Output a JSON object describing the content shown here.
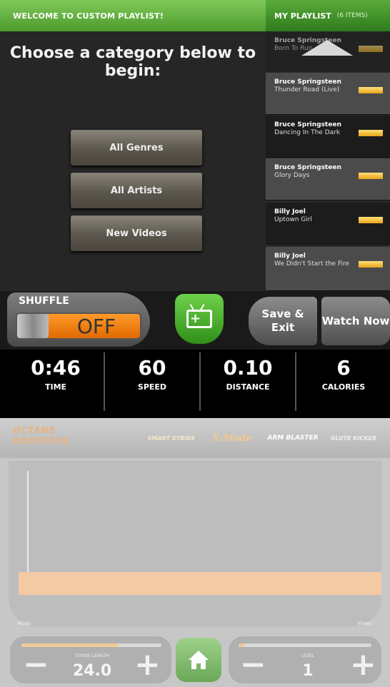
{
  "header": {
    "welcome": "WELCOME TO CUSTOM PLAYLIST!",
    "playlist_title": "MY PLAYLIST",
    "playlist_count": "(6 ITEMS)"
  },
  "prompt": "Choose a category below to begin:",
  "categories": [
    "All Genres",
    "All Artists",
    "New Videos"
  ],
  "playlist": [
    {
      "artist": "Bruce Springsteen",
      "song": "Born To Run"
    },
    {
      "artist": "Bruce Springsteen",
      "song": "Thunder Road (Live)"
    },
    {
      "artist": "Bruce Springsteen",
      "song": "Dancing In The Dark"
    },
    {
      "artist": "Bruce Springsteen",
      "song": "Glory Days"
    },
    {
      "artist": "Billy Joel",
      "song": "Uptown Girl"
    },
    {
      "artist": "Billy Joel",
      "song": "We Didn't Start the Fire"
    }
  ],
  "controls": {
    "shuffle_label": "SHUFFLE",
    "shuffle_state": "OFF",
    "save_exit": "Save & Exit",
    "watch_now": "Watch Now"
  },
  "stats": [
    {
      "value": "0:46",
      "label": "TIME"
    },
    {
      "value": "60",
      "label": "SPEED"
    },
    {
      "value": "0.10",
      "label": "DISTANCE"
    },
    {
      "value": "6",
      "label": "CALORIES"
    }
  ],
  "boosters": {
    "title": "OCTANE BOOSTERS",
    "tabs": [
      "SMART STRIDE",
      "X-Mode",
      "ARM BLASTER",
      "GLUTE KICKER"
    ],
    "left_label": "Mode",
    "right_label": "Views"
  },
  "bottom": {
    "stride_label": "STRIDE LENGTH",
    "stride_value": "24.0",
    "level_label": "LEVEL",
    "level_value": "1"
  },
  "colors": {
    "header_green": "#5aaa3a",
    "accent_orange": "#f28a1a",
    "playlist_bar": "#f0b52a",
    "booster_band": "#f2caa4"
  }
}
